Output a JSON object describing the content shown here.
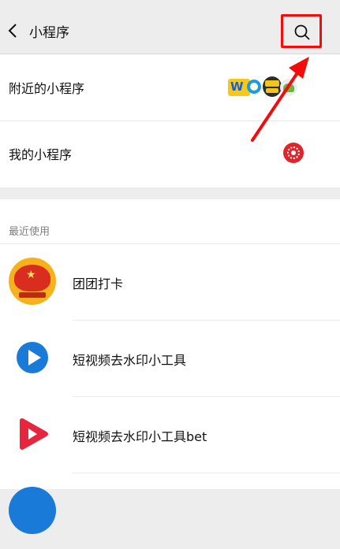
{
  "nav": {
    "title": "小程序",
    "back_icon": "chevron-left-icon",
    "search_icon": "search-icon",
    "highlight_color": "#f20c0c"
  },
  "entries": [
    {
      "label": "附近的小程序"
    },
    {
      "label": "我的小程序"
    }
  ],
  "recent": {
    "section_title": "最近使用",
    "items": [
      {
        "name": "团团打卡",
        "icon": "tuantuan-app-icon"
      },
      {
        "name": "短视频去水印小工具",
        "icon": "blue-play-app-icon"
      },
      {
        "name": "短视频去水印小工具bet",
        "icon": "red-play-app-icon"
      }
    ]
  },
  "colors": {
    "background": "#ededed",
    "card": "#ffffff",
    "annotation_red": "#f20c0c"
  }
}
